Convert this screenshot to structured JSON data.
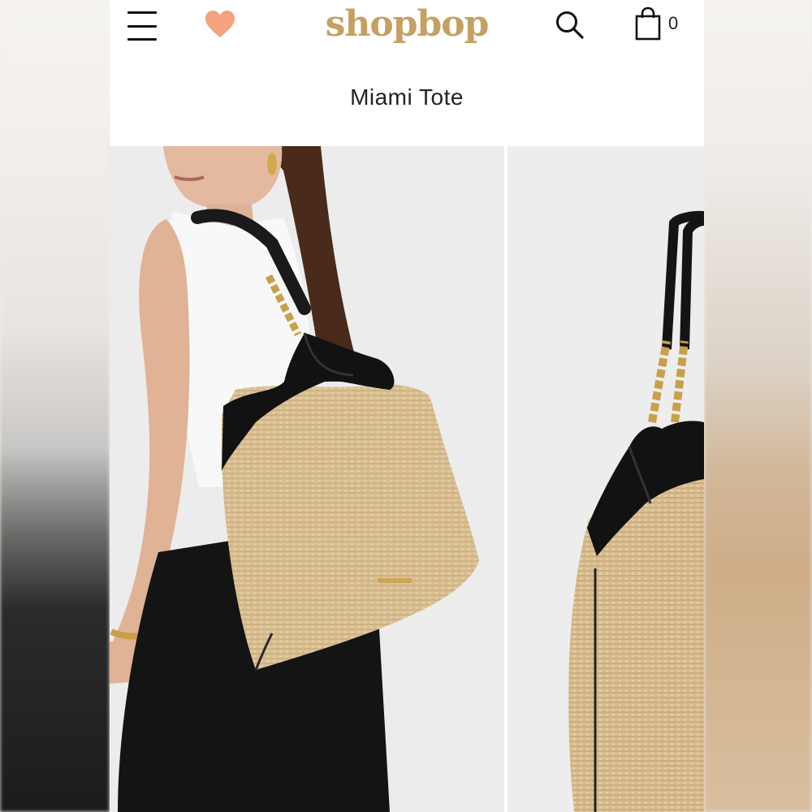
{
  "header": {
    "logo": "shopbop",
    "cart_count": "0"
  },
  "product": {
    "title": "Miami Tote"
  },
  "gallery": {
    "images": [
      "model-wearing-tote-photo",
      "tote-detail-photo"
    ]
  },
  "colors": {
    "logo_gold": "#c5a063",
    "heart": "#f4a27f",
    "raffia": "#d9bf93",
    "leather": "#111111"
  }
}
